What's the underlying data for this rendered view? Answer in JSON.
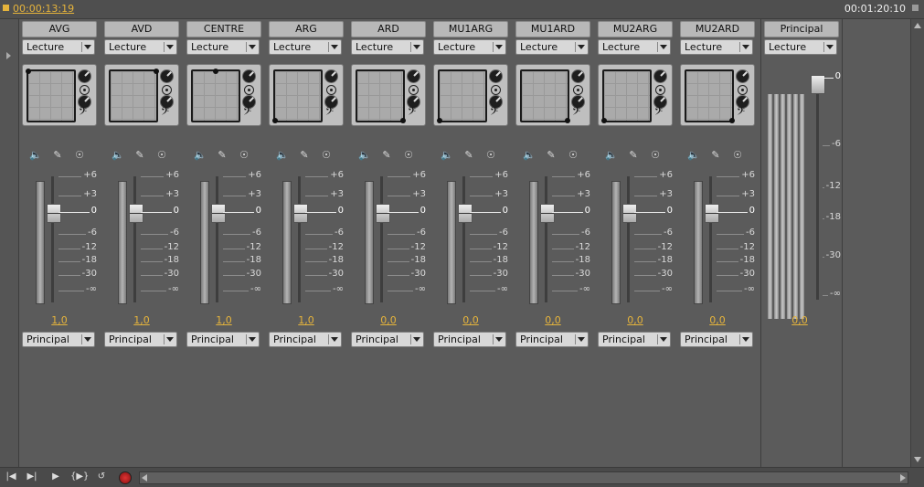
{
  "timecode_current": "00:00:13:19",
  "timecode_duration": "00:01:20:10",
  "tracks": [
    {
      "name": "AVG",
      "mode": "Lecture",
      "output": "Principal",
      "volume": "1,0"
    },
    {
      "name": "AVD",
      "mode": "Lecture",
      "output": "Principal",
      "volume": "1,0"
    },
    {
      "name": "CENTRE",
      "mode": "Lecture",
      "output": "Principal",
      "volume": "1,0"
    },
    {
      "name": "ARG",
      "mode": "Lecture",
      "output": "Principal",
      "volume": "1,0"
    },
    {
      "name": "ARD",
      "mode": "Lecture",
      "output": "Principal",
      "volume": "0,0"
    },
    {
      "name": "MU1ARG",
      "mode": "Lecture",
      "output": "Principal",
      "volume": "0,0"
    },
    {
      "name": "MU1ARD",
      "mode": "Lecture",
      "output": "Principal",
      "volume": "0,0"
    },
    {
      "name": "MU2ARG",
      "mode": "Lecture",
      "output": "Principal",
      "volume": "0,0"
    },
    {
      "name": "MU2ARD",
      "mode": "Lecture",
      "output": "Principal",
      "volume": "0,0"
    }
  ],
  "master": {
    "name": "Principal",
    "mode": "Lecture",
    "volume": "0,0"
  },
  "track_scale": [
    "+6",
    "+3",
    "0",
    "-6",
    "-12",
    "-18",
    "-30",
    "-∞"
  ],
  "master_scale": [
    "0",
    "-6",
    "-12",
    "-18",
    "-30",
    "-∞"
  ],
  "icons": [
    "speaker-icon",
    "pencil-icon",
    "microphone-icon"
  ],
  "colors": {
    "accent": "#e6b43c",
    "background": "#5b5b5b"
  }
}
